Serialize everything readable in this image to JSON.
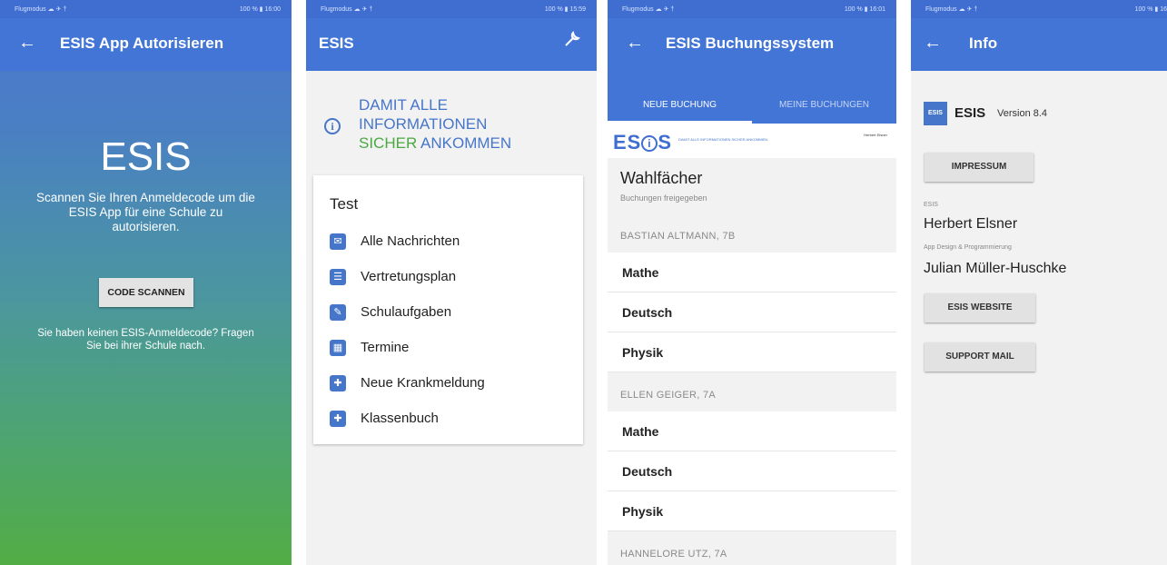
{
  "status": {
    "carrier": "Flugmodus ☁ ✈ †",
    "p1_right": "100 % ▮ 16:00",
    "p2_right": "100 % ▮ 15:59",
    "p3_right": "100 % ▮ 16:01",
    "p4_right": "100 % ▮ 16"
  },
  "screen1": {
    "title": "ESIS App Autorisieren",
    "brand": "ESIS",
    "description": "Scannen Sie Ihren Anmeldecode um die ESIS App für eine Schule zu autorisieren.",
    "button": "CODE SCANNEN",
    "footer": "Sie haben keinen ESIS-Anmeldecode? Fragen Sie bei ihrer Schule nach."
  },
  "screen2": {
    "title": "ESIS",
    "slogan_line1": "DAMIT ALLE",
    "slogan_line2": "INFORMATIONEN",
    "slogan_green": "SICHER",
    "slogan_line3": " ANKOMMEN",
    "card_title": "Test",
    "menu": [
      {
        "label": "Alle Nachrichten",
        "icon": "mail-icon"
      },
      {
        "label": "Vertretungsplan",
        "icon": "list-icon"
      },
      {
        "label": "Schulaufgaben",
        "icon": "exam-icon"
      },
      {
        "label": "Termine",
        "icon": "calendar-icon"
      },
      {
        "label": "Neue Krankmeldung",
        "icon": "heartbeat-icon"
      },
      {
        "label": "Klassenbuch",
        "icon": "book-icon"
      }
    ]
  },
  "screen3": {
    "title": "ESIS Buchungssystem",
    "tabs": [
      "NEUE BUCHUNG",
      "MEINE BUCHUNGEN"
    ],
    "logo_text": "ES",
    "logo_text2": "S",
    "logo_tagline": "DAMIT ALLE INFORMATIONEN SICHER ANKOMMEN",
    "logo_right": "Herbert Elsner",
    "section_title": "Wahlfächer",
    "section_sub": "Buchungen freigegeben",
    "groups": [
      {
        "teacher": "BASTIAN ALTMANN, 7B",
        "subjects": [
          "Mathe",
          "Deutsch",
          "Physik"
        ]
      },
      {
        "teacher": "ELLEN GEIGER, 7A",
        "subjects": [
          "Mathe",
          "Deutsch",
          "Physik"
        ]
      },
      {
        "teacher": "HANNELORE UTZ, 7A",
        "subjects": []
      }
    ]
  },
  "screen4": {
    "title": "Info",
    "logo": "ESIS",
    "app_name": "ESIS",
    "version": "Version 8.4",
    "impressum": "IMPRESSUM",
    "label1": "ESIS",
    "name1": "Herbert Elsner",
    "label2": "App Design & Programmierung",
    "name2": "Julian Müller-Huschke",
    "website": "ESIS WEBSITE",
    "support": "SUPPORT MAIL"
  }
}
